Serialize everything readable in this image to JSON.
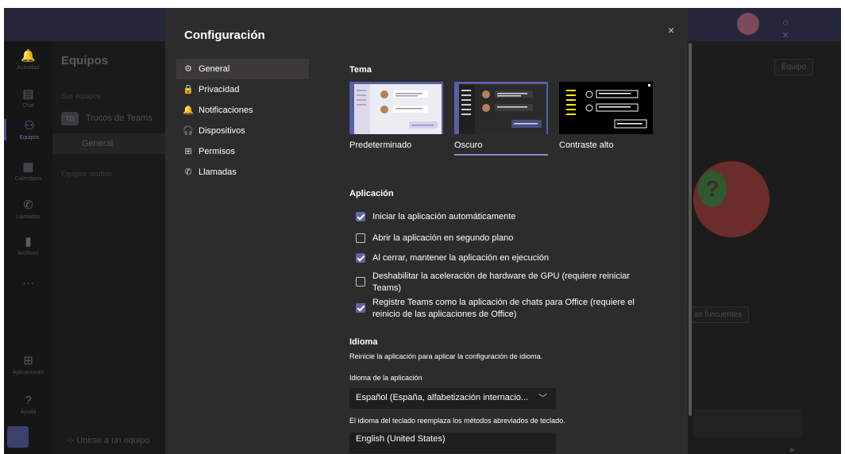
{
  "background": {
    "rail": [
      {
        "label": "Actividad",
        "icon": "bell-icon",
        "glyph": "🔔"
      },
      {
        "label": "Chat",
        "icon": "chat-icon",
        "glyph": "▤"
      },
      {
        "label": "Equipos",
        "icon": "teams-icon",
        "glyph": "⚇"
      },
      {
        "label": "Calendario",
        "icon": "calendar-icon",
        "glyph": "▦"
      },
      {
        "label": "Llamadas",
        "icon": "phone-icon",
        "glyph": "✆"
      },
      {
        "label": "Archivos",
        "icon": "file-icon",
        "glyph": "▮"
      },
      {
        "label": "",
        "icon": "more-icon",
        "glyph": "···"
      },
      {
        "label": "Aplicaciones",
        "icon": "apps-icon",
        "glyph": "⊞"
      },
      {
        "label": "Ayuda",
        "icon": "help-icon",
        "glyph": "?"
      }
    ],
    "teams_title": "Equipos",
    "my_teams": "Sus equipos",
    "team_badge": "TD",
    "team_name": "Trucos de Teams",
    "channel": "General",
    "hidden_teams": "Equipos ocultos",
    "join_team": "Unirse a un equipo",
    "team_button": "Equipo",
    "frequent_button": "as frecuentes"
  },
  "dialog": {
    "title": "Configuración",
    "close_glyph": "×",
    "nav": [
      {
        "label": "General",
        "icon": "gear-icon",
        "glyph": "⚙",
        "active": true
      },
      {
        "label": "Privacidad",
        "icon": "lock-icon",
        "glyph": "🔒",
        "active": false
      },
      {
        "label": "Notificaciones",
        "icon": "bell-icon",
        "glyph": "🔔",
        "active": false
      },
      {
        "label": "Dispositivos",
        "icon": "headset-icon",
        "glyph": "🎧",
        "active": false
      },
      {
        "label": "Permisos",
        "icon": "shield-icon",
        "glyph": "⊞",
        "active": false
      },
      {
        "label": "Llamadas",
        "icon": "phone-icon",
        "glyph": "✆",
        "active": false
      }
    ],
    "theme_section": "Tema",
    "themes": [
      {
        "label": "Predeterminado",
        "selected": false
      },
      {
        "label": "Oscuro",
        "selected": true
      },
      {
        "label": "Contraste alto",
        "selected": false
      }
    ],
    "app_section": "Aplicación",
    "options": [
      {
        "label": "Iniciar la aplicación automáticamente",
        "checked": true
      },
      {
        "label": "Abrir la aplicación en segundo plano",
        "checked": false
      },
      {
        "label": "Al cerrar, mantener la aplicación en ejecución",
        "checked": true
      },
      {
        "label": "Deshabilitar la aceleración de hardware de GPU (requiere reiniciar Teams)",
        "checked": false
      },
      {
        "label": "Registre Teams como la aplicación de chats para Office (requiere el reinicio de las aplicaciones de Office)",
        "checked": true
      }
    ],
    "language_section": "Idioma",
    "language_note": "Reinicie la aplicación para aplicar la configuración de idioma.",
    "app_language_label": "Idioma de la aplicación",
    "app_language_value": "Español (España, alfabetización internacio...",
    "keyboard_note": "El idioma del teclado reemplaza los métodos abreviados de teclado.",
    "keyboard_language_value": "English (United States)"
  },
  "colors": {
    "accent": "#6264a7",
    "dialog_bg": "#2d2c2c",
    "selected_nav": "#3b3a39"
  }
}
